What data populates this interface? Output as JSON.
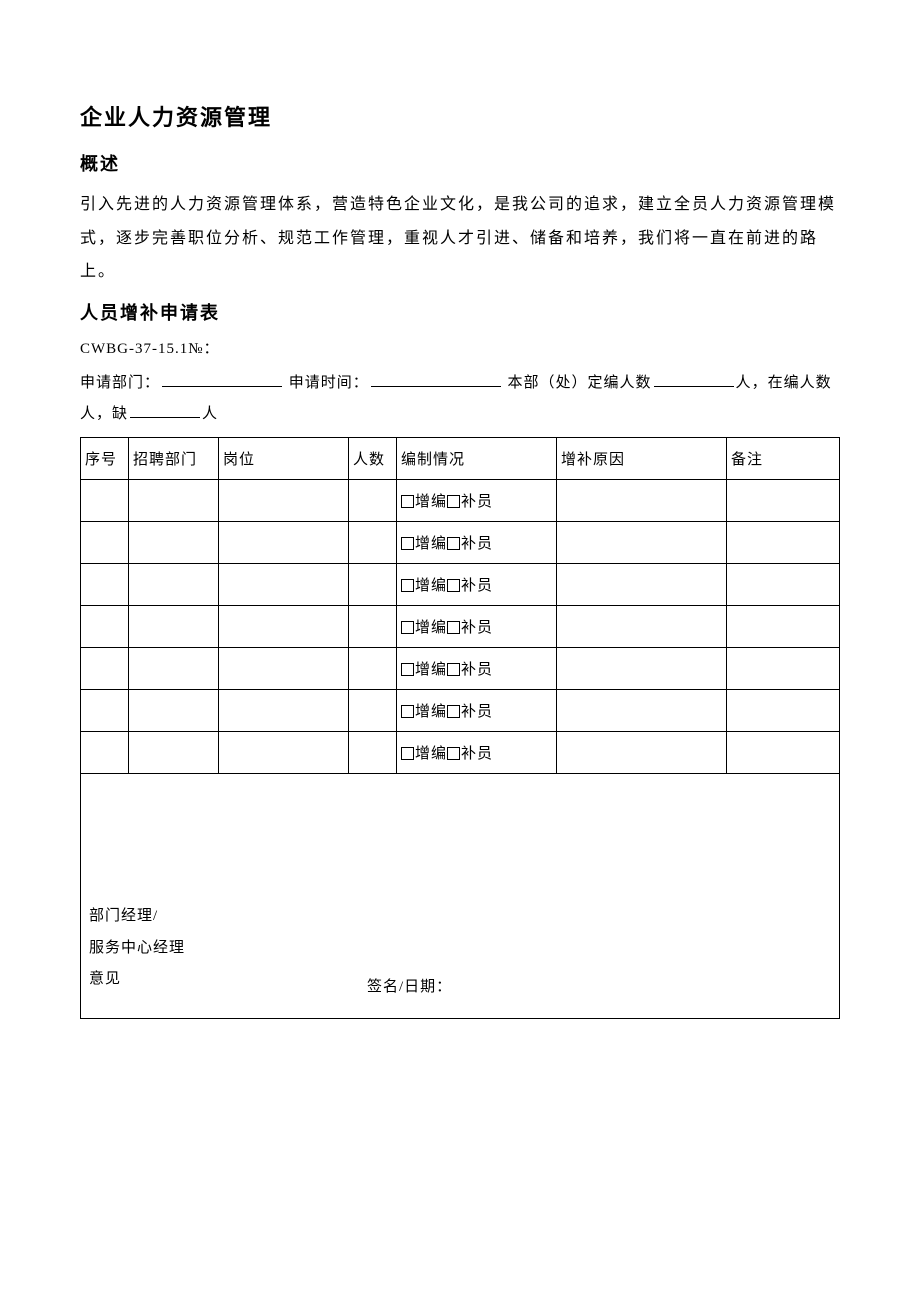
{
  "title": "企业人力资源管理",
  "overview_heading": "概述",
  "overview_body": "引入先进的人力资源管理体系，营造特色企业文化，是我公司的追求，建立全员人力资源管理模式，逐步完善职位分析、规范工作管理，重视人才引进、储备和培养，我们将一直在前进的路上。",
  "form_heading": "人员增补申请表",
  "form_code": "CWBG-37-15.1№：",
  "fill_line": {
    "apply_dept_label": "申请部门：",
    "apply_time_label": "申请时间：",
    "dept_quota_prefix": "本部（处）定编人数",
    "person_unit": "人",
    "in_post_label": "，在编人数",
    "person_unit_2": "人",
    "short_label": "，缺",
    "person_unit_3": "人"
  },
  "table": {
    "headers": {
      "seq": "序号",
      "dept": "招聘部门",
      "post": "岗位",
      "num": "人数",
      "status": "编制情况",
      "reason": "增补原因",
      "remark": "备注"
    },
    "status_option_a": "增编",
    "status_option_b": "补员",
    "row_count": 7,
    "comment_block": {
      "left_line1": "部门经理/",
      "left_line2": "服务中心经理",
      "left_line3": "意见",
      "sign_label": "签名/日期："
    }
  }
}
